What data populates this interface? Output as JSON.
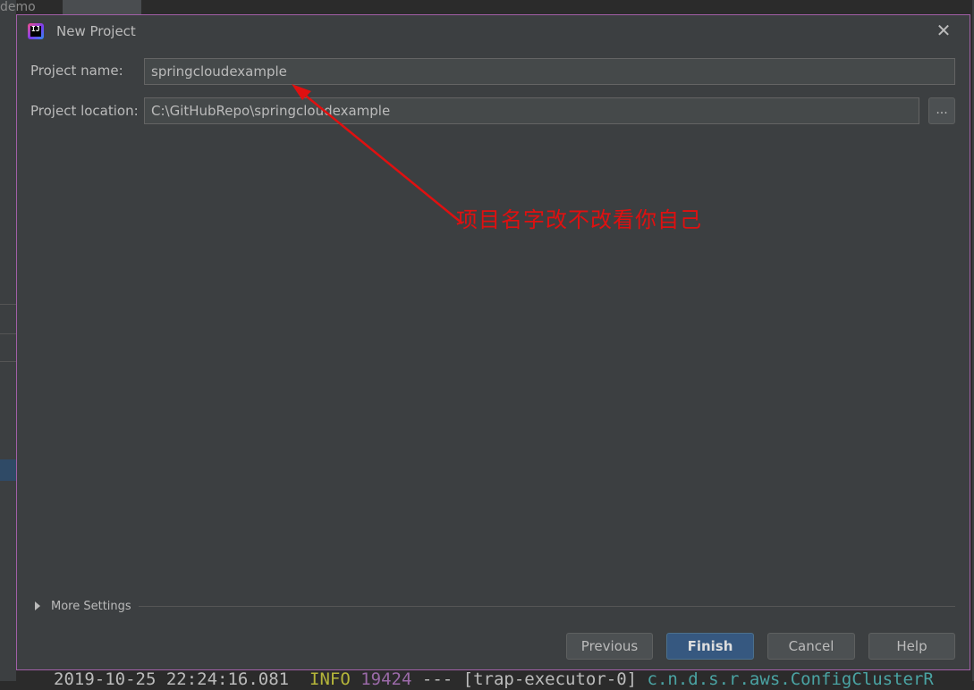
{
  "background": {
    "tab_label": "demo",
    "log_line": {
      "timestamp": "2019-10-25 22:24:16.081",
      "level": "INFO",
      "pid": "19424",
      "thread": "--- [trap-executor-0]",
      "logger": "c.n.d.s.r.aws.ConfigClusterR"
    }
  },
  "dialog": {
    "title": "New Project",
    "icon": "intellij-idea-icon",
    "close_icon": "close-icon",
    "project_name_label": "Project name:",
    "project_name_value": "springcloudexample",
    "project_location_label": "Project location:",
    "project_location_value": "C:\\GitHubRepo\\springcloudexample",
    "browse_label": "...",
    "more_settings_label": "More Settings",
    "buttons": {
      "previous": "Previous",
      "finish": "Finish",
      "cancel": "Cancel",
      "help": "Help"
    }
  },
  "annotation": {
    "text": "项目名字改不改看你自己",
    "color": "#e01010"
  },
  "colors": {
    "dialog_bg": "#3c3f41",
    "dialog_border": "#a25fa8",
    "primary_button": "#365880"
  }
}
